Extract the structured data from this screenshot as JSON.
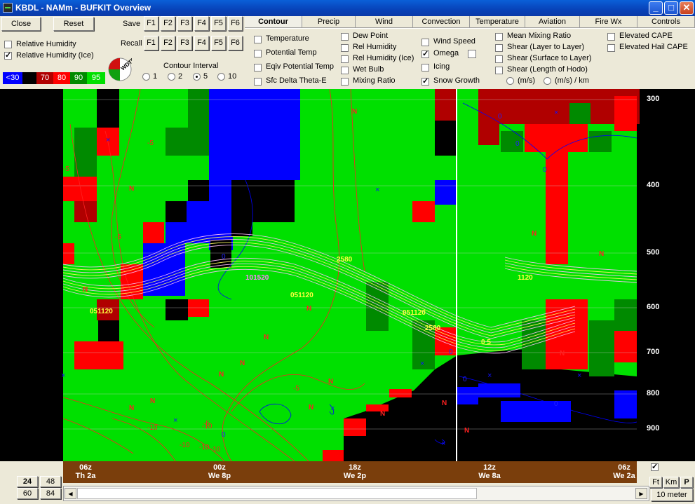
{
  "window": {
    "title": "KBDL - NAMm - BUFKIT Overview",
    "minimize": "_",
    "maximize": "□",
    "close": "✕"
  },
  "buttons": {
    "close": "Close",
    "reset": "Reset",
    "save": "Save",
    "recall": "Recall"
  },
  "fkeys": [
    "F1",
    "F2",
    "F3",
    "F4",
    "F5",
    "F6"
  ],
  "left_checks": [
    {
      "label": "Relative Humidity",
      "checked": false
    },
    {
      "label": "Relative Humidity (Ice)",
      "checked": true
    }
  ],
  "legend": [
    {
      "label": "<30",
      "color": "#0000ff"
    },
    {
      "label": "",
      "color": "#000000"
    },
    {
      "label": "70",
      "color": "#b00000"
    },
    {
      "label": "80",
      "color": "#ff0000"
    },
    {
      "label": "90",
      "color": "#008a00"
    },
    {
      "label": "95",
      "color": "#00e000"
    }
  ],
  "contour_interval": {
    "label": "Contour Interval",
    "options": [
      "1",
      "2",
      "5",
      "10"
    ],
    "selected": "5"
  },
  "tabs": [
    "Contour",
    "Precip",
    "Wind",
    "Convection",
    "Temperature",
    "Aviation",
    "Fire Wx",
    "Controls"
  ],
  "active_tab": "Contour",
  "contour_options": {
    "col1": [
      {
        "label": "Temperature",
        "checked": false
      },
      {
        "label": "Potential Temp",
        "checked": false
      },
      {
        "label": "Eqiv Potential Temp",
        "checked": false
      },
      {
        "label": "Sfc Delta Theta-E",
        "checked": false
      }
    ],
    "col2": [
      {
        "label": "Dew Point",
        "checked": false
      },
      {
        "label": "Rel Humidity",
        "checked": false
      },
      {
        "label": "Rel Humidity (Ice)",
        "checked": false
      },
      {
        "label": "Wet Bulb",
        "checked": false
      },
      {
        "label": "Mixing Ratio",
        "checked": false
      }
    ],
    "col3": [
      {
        "label": "Wind Speed",
        "checked": false
      },
      {
        "label": "Omega",
        "checked": true
      },
      {
        "label": "Icing",
        "checked": false
      },
      {
        "label": "Snow Growth",
        "checked": true
      }
    ],
    "col4": [
      {
        "label": "Mean Mixing Ratio",
        "checked": false
      },
      {
        "label": "Shear (Layer to Layer)",
        "checked": false
      },
      {
        "label": "Shear (Surface to Layer)",
        "checked": false
      },
      {
        "label": "Shear (Length of Hodo)",
        "checked": false
      }
    ],
    "shear_units": [
      "(m/s)",
      "(m/s) / km"
    ],
    "col5": [
      {
        "label": "Elevated CAPE",
        "checked": false
      },
      {
        "label": "Elevated Hail CAPE",
        "checked": false
      }
    ]
  },
  "pressure_levels": [
    "300",
    "400",
    "500",
    "600",
    "700",
    "800",
    "900"
  ],
  "time_axis": [
    {
      "hour": "06z",
      "day": "Th 2a"
    },
    {
      "hour": "00z",
      "day": "We 8p"
    },
    {
      "hour": "18z",
      "day": "We 2p"
    },
    {
      "hour": "12z",
      "day": "We 8a"
    },
    {
      "hour": "06z",
      "day": "We 2a"
    }
  ],
  "bottom_left": [
    "24",
    "48",
    "60",
    "84"
  ],
  "bottom_right": {
    "checked": true,
    "units": [
      "Ft",
      "Km",
      "P"
    ],
    "wind_level": "10 meter"
  },
  "plot_labels": {
    "contour_values": [
      "-5",
      "-5",
      "-5",
      "-5",
      "-5",
      "-10",
      "-10",
      "-10",
      "-10",
      "-10",
      "0",
      "0",
      "0",
      "0",
      "0",
      "0",
      "0",
      "0"
    ],
    "snow_growth": [
      "2580",
      "101520",
      "051120",
      "051120",
      "051120",
      "2580",
      "1120",
      "0 5"
    ],
    "colors": {
      "rh95": "#00e000",
      "rh90": "#008a00",
      "rh80": "#ff0000",
      "rh70": "#b00000",
      "rh30": "#0000ff",
      "dry": "#000000",
      "omega": "#ff2020",
      "wind_x": "#0000ff",
      "sg": "#ffff00"
    }
  }
}
